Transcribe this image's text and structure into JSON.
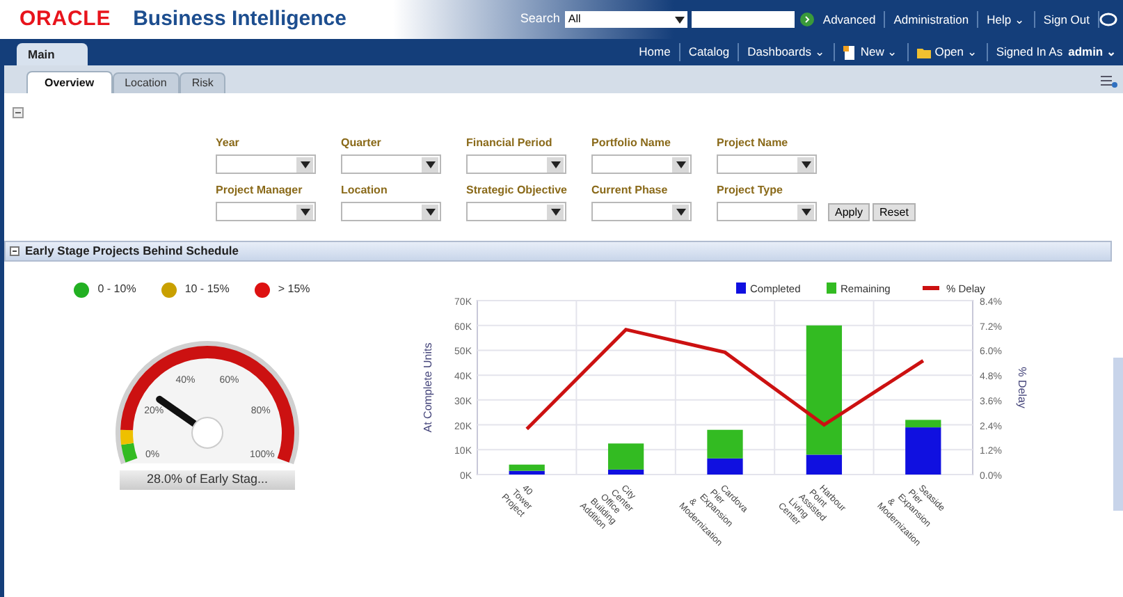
{
  "header": {
    "logo": "ORACLE",
    "product": "Business Intelligence",
    "search_label": "Search",
    "search_scope": "All",
    "links": [
      "Advanced",
      "Administration",
      "Help ⌄",
      "Sign Out"
    ]
  },
  "nav": {
    "tab": "Main",
    "links": [
      {
        "label": "Home",
        "kind": "plain"
      },
      {
        "label": "Catalog",
        "kind": "plain"
      },
      {
        "label": "Dashboards ⌄",
        "kind": "plain"
      },
      {
        "label": "New ⌄",
        "kind": "new"
      },
      {
        "label": "Open ⌄",
        "kind": "folder"
      }
    ],
    "signed_in": "Signed In As",
    "user": "admin ⌄"
  },
  "tabs": [
    {
      "label": "Overview",
      "selected": true
    },
    {
      "label": "Location",
      "selected": false
    },
    {
      "label": "Risk",
      "selected": false
    }
  ],
  "filters": [
    [
      {
        "label": "Year"
      },
      {
        "label": "Quarter"
      },
      {
        "label": "Financial Period"
      },
      {
        "label": "Portfolio Name"
      },
      {
        "label": "Project Name"
      }
    ],
    [
      {
        "label": "Project Manager"
      },
      {
        "label": "Location"
      },
      {
        "label": "Strategic Objective"
      },
      {
        "label": "Current Phase"
      },
      {
        "label": "Project Type"
      }
    ]
  ],
  "buttons": [
    "Apply",
    "Reset"
  ],
  "section": {
    "title": "Early Stage Projects Behind Schedule",
    "expanded": true
  },
  "gauge": {
    "legend": [
      {
        "label": "0 - 10%",
        "color": "#22b022"
      },
      {
        "label": "10 - 15%",
        "color": "#c9a000"
      },
      {
        "label": "> 15%",
        "color": "#dd1111"
      }
    ],
    "ticks": [
      "0%",
      "20%",
      "40%",
      "60%",
      "80%",
      "100%"
    ],
    "level": 0.25,
    "caption": "28.0% of Early Stag..."
  },
  "chart_data": {
    "type": "bar",
    "stacked": true,
    "ylabel": "At Complete Units",
    "y2label": "% Delay",
    "categories": [
      "40 Tower Project",
      "City Center Office Building Addition",
      "Cardova Pier Expansion & Modernization",
      "Harbour Point Assisted Living Center",
      "Seaside Pier Expansion & Modernization"
    ],
    "series": [
      {
        "name": "Completed",
        "color": "#1010e0",
        "values": [
          1500,
          2000,
          6500,
          8000,
          19000
        ]
      },
      {
        "name": "Remaining",
        "color": "#33bb22",
        "values": [
          2500,
          10500,
          11500,
          52000,
          3000
        ]
      },
      {
        "name": "% Delay",
        "color": "#cc1111",
        "type": "line",
        "axis": "y2",
        "values": [
          2.2,
          7.0,
          5.9,
          2.4,
          5.5
        ]
      }
    ],
    "grid": true,
    "legend": "top",
    "ylim": [
      0,
      70000
    ],
    "yticks": [
      {
        "value": 0,
        "label": "0K"
      },
      {
        "value": 10000,
        "label": "10K"
      },
      {
        "value": 20000,
        "label": "20K"
      },
      {
        "value": 30000,
        "label": "30K"
      },
      {
        "value": 40000,
        "label": "40K"
      },
      {
        "value": 50000,
        "label": "50K"
      },
      {
        "value": 60000,
        "label": "60K"
      },
      {
        "value": 70000,
        "label": "70K"
      }
    ],
    "y2lim": [
      0,
      8.4
    ],
    "y2ticks": [
      {
        "value": 0,
        "label": "0.0%"
      },
      {
        "value": 1.2,
        "label": "1.2%"
      },
      {
        "value": 2.4,
        "label": "2.4%"
      },
      {
        "value": 3.6,
        "label": "3.6%"
      },
      {
        "value": 4.8,
        "label": "4.8%"
      },
      {
        "value": 6,
        "label": "6.0%"
      },
      {
        "value": 7.2,
        "label": "7.2%"
      },
      {
        "value": 8.4,
        "label": "8.4%"
      }
    ]
  }
}
